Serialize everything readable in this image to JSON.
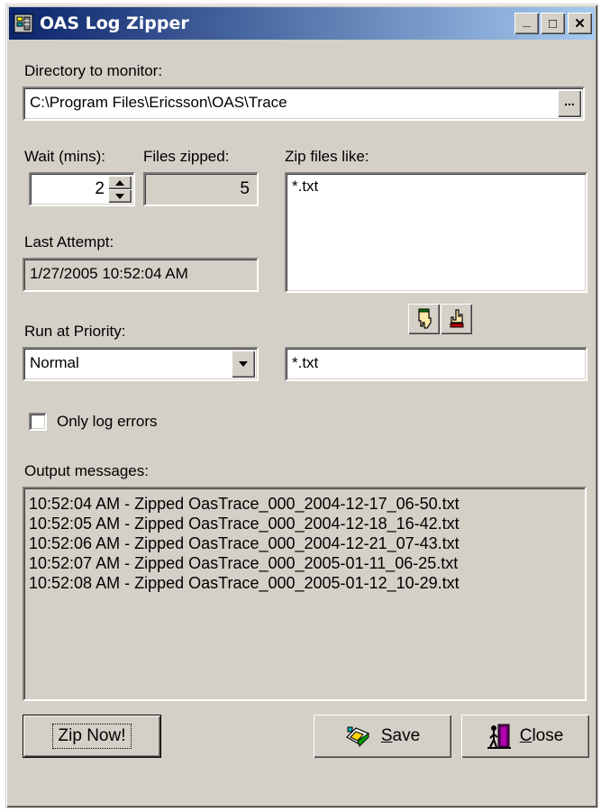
{
  "window": {
    "title": "OAS Log Zipper",
    "controls": {
      "minimize": "_",
      "maximize": "□",
      "close": "✕"
    }
  },
  "directory": {
    "label": "Directory to monitor:",
    "value": "C:\\Program Files\\Ericsson\\OAS\\Trace",
    "browse_label": "..."
  },
  "wait": {
    "label": "Wait (mins):",
    "value": "2"
  },
  "files_zipped": {
    "label": "Files zipped:",
    "value": "5"
  },
  "zip_files_like": {
    "label": "Zip files like:",
    "items": [
      "*.txt"
    ],
    "new_pattern_value": "*.txt"
  },
  "last_attempt": {
    "label": "Last Attempt:",
    "value": "1/27/2005 10:52:04 AM"
  },
  "priority": {
    "label": "Run at Priority:",
    "selected": "Normal"
  },
  "only_log_errors": {
    "label": "Only log errors",
    "checked": false
  },
  "output": {
    "label": "Output messages:",
    "lines": [
      "10:52:04 AM - Zipped OasTrace_000_2004-12-17_06-50.txt",
      "10:52:05 AM - Zipped OasTrace_000_2004-12-18_16-42.txt",
      "10:52:06 AM - Zipped OasTrace_000_2004-12-21_07-43.txt",
      "10:52:07 AM - Zipped OasTrace_000_2005-01-11_06-25.txt",
      "10:52:08 AM - Zipped OasTrace_000_2005-01-12_10-29.txt"
    ]
  },
  "buttons": {
    "zip_now": "Zip Now!",
    "save_hotkey": "S",
    "save_rest": "ave",
    "close_hotkey": "C",
    "close_rest": "lose"
  },
  "icons": {
    "app": "zipper-app-icon",
    "add_pattern": "hand-down-icon",
    "remove_pattern": "hand-up-icon",
    "save": "save-icon",
    "close": "door-exit-icon"
  },
  "colors": {
    "face": "#d4d0c8",
    "title_start": "#0a246a",
    "title_end": "#a6caf0"
  }
}
